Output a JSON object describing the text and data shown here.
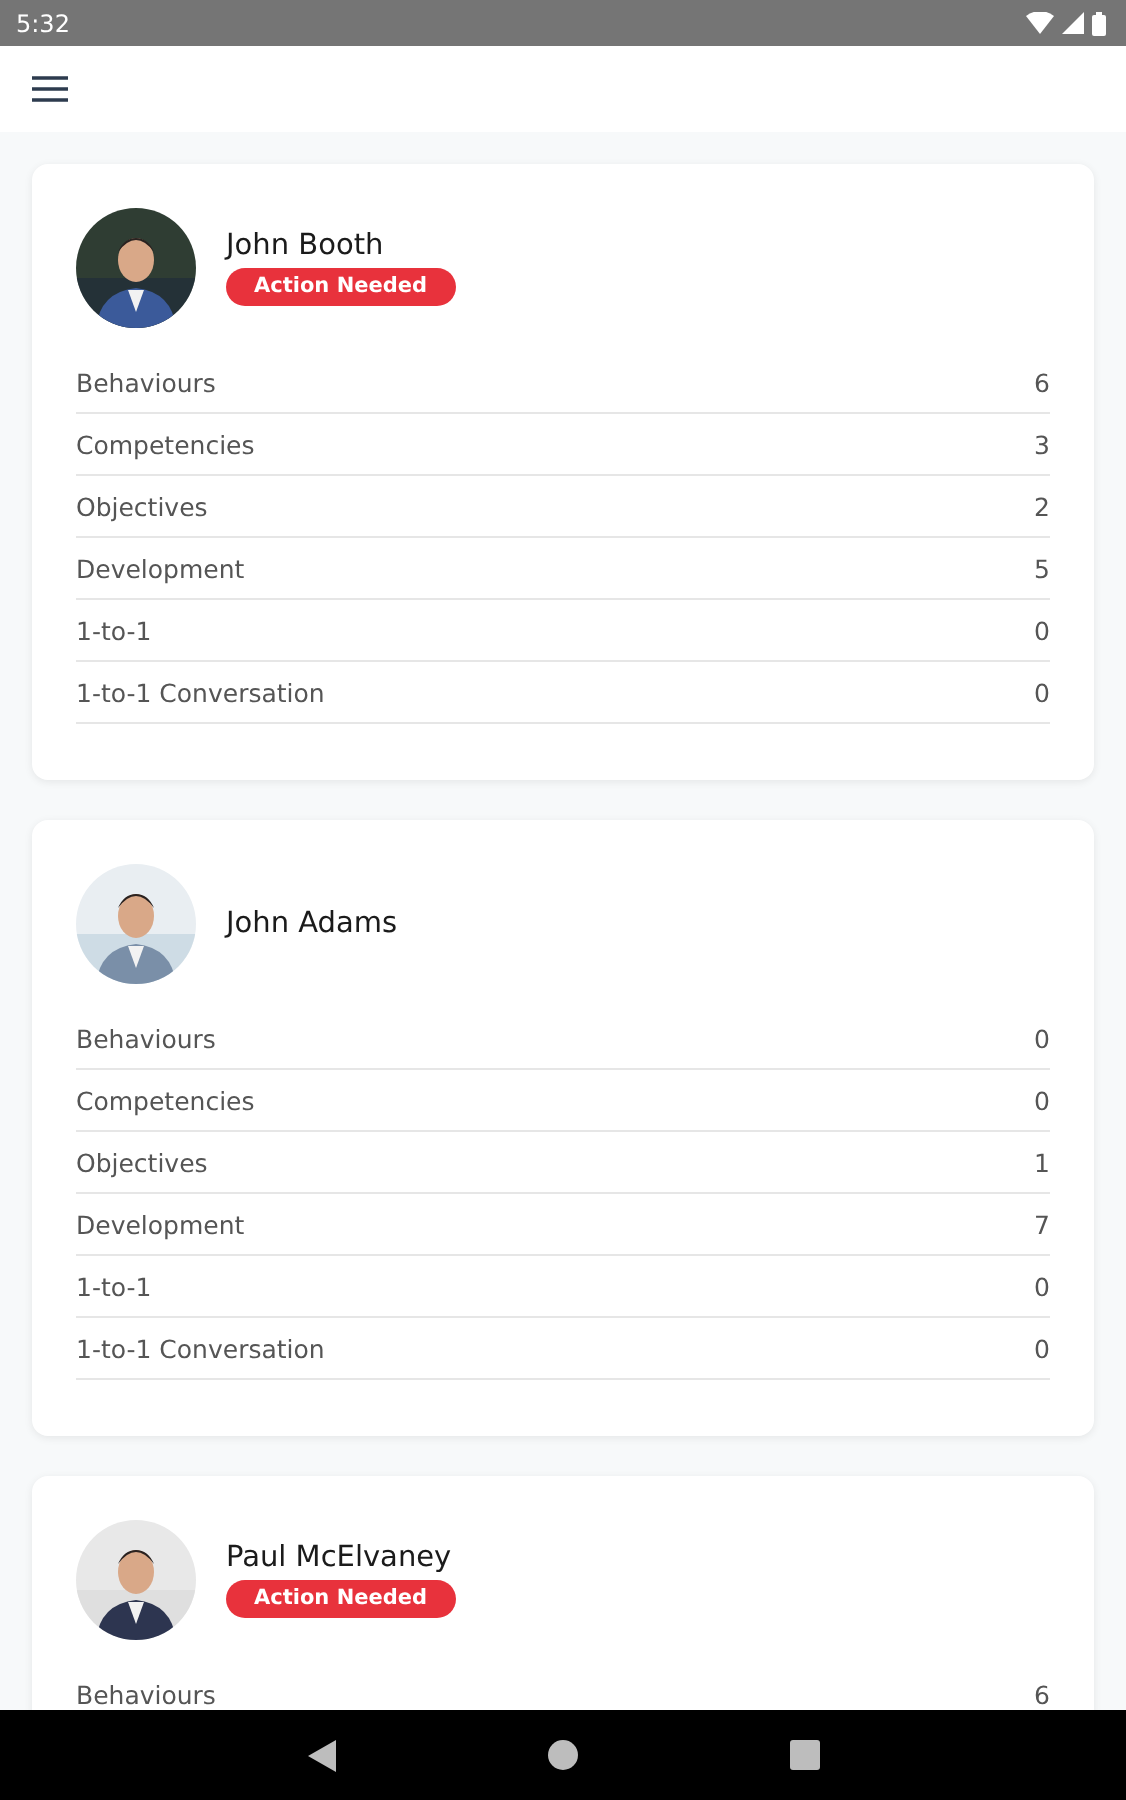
{
  "status_bar": {
    "time": "5:32"
  },
  "people": [
    {
      "name": "John Booth",
      "badge": "Action Needed",
      "rows": [
        {
          "label": "Behaviours",
          "count": "6"
        },
        {
          "label": "Competencies",
          "count": "3"
        },
        {
          "label": "Objectives",
          "count": "2"
        },
        {
          "label": "Development",
          "count": "5"
        },
        {
          "label": "1-to-1",
          "count": "0"
        },
        {
          "label": "1-to-1 Conversation",
          "count": "0"
        }
      ]
    },
    {
      "name": "John Adams",
      "rows": [
        {
          "label": "Behaviours",
          "count": "0"
        },
        {
          "label": "Competencies",
          "count": "0"
        },
        {
          "label": "Objectives",
          "count": "1"
        },
        {
          "label": "Development",
          "count": "7"
        },
        {
          "label": "1-to-1",
          "count": "0"
        },
        {
          "label": "1-to-1 Conversation",
          "count": "0"
        }
      ]
    },
    {
      "name": "Paul McElvaney",
      "badge": "Action Needed",
      "rows": [
        {
          "label": "Behaviours",
          "count": "6"
        }
      ]
    }
  ]
}
